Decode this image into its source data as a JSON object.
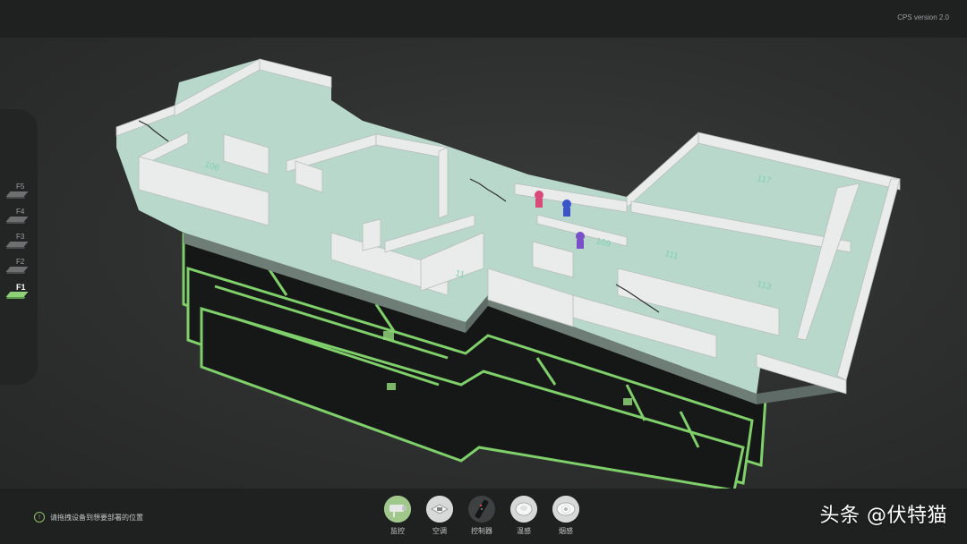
{
  "header": {
    "version": "CPS version 2.0"
  },
  "floors": [
    {
      "label": "F5",
      "active": false
    },
    {
      "label": "F4",
      "active": false
    },
    {
      "label": "F3",
      "active": false
    },
    {
      "label": "F2",
      "active": false
    },
    {
      "label": "F1",
      "active": true
    }
  ],
  "rooms": {
    "r106": "106",
    "r117": "117",
    "r111": "111",
    "r113": "113",
    "r109": "109",
    "r11": "11"
  },
  "hint": {
    "text": "请拖拽设备到想要部署的位置"
  },
  "devices": [
    {
      "label": "监控",
      "icon": "camera-icon"
    },
    {
      "label": "空调",
      "icon": "air-conditioner-icon"
    },
    {
      "label": "控制器",
      "icon": "controller-icon"
    },
    {
      "label": "温感",
      "icon": "temperature-sensor-icon"
    },
    {
      "label": "烟感",
      "icon": "smoke-detector-icon"
    }
  ],
  "watermark": "头条 @伏特猫",
  "colors": {
    "accent": "#8fd17a",
    "floor": "#b9d8cc",
    "wall": "#e9ecea"
  }
}
